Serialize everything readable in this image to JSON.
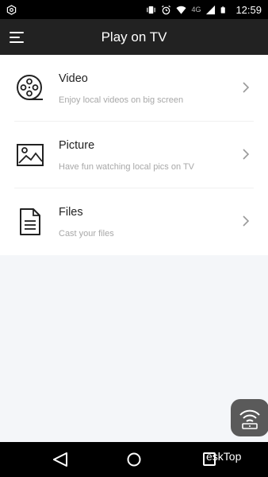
{
  "status_bar": {
    "network": "4G",
    "time": "12:59"
  },
  "app_bar": {
    "title": "Play on TV",
    "menu_icon": "menu-icon"
  },
  "items": [
    {
      "title": "Video",
      "subtitle": "Enjoy local videos on big screen",
      "icon": "film-reel-icon"
    },
    {
      "title": "Picture",
      "subtitle": "Have fun watching local pics on TV",
      "icon": "image-icon"
    },
    {
      "title": "Files",
      "subtitle": "Cast your files",
      "icon": "document-icon"
    }
  ],
  "fab": {
    "icon": "cast-wifi-icon"
  },
  "watermark": "ēskTop"
}
